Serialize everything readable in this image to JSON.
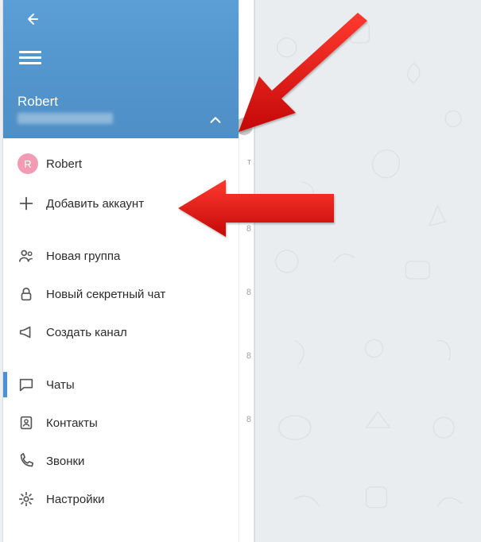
{
  "header": {
    "user_name": "Robert",
    "avatar_initial": "R"
  },
  "accounts": {
    "current_label": "Robert",
    "add_label": "Добавить аккаунт"
  },
  "menu": {
    "new_group": "Новая группа",
    "secret_chat": "Новый секретный чат",
    "create_channel": "Создать канал",
    "chats": "Чаты",
    "contacts": "Контакты",
    "calls": "Звонки",
    "settings": "Настройки"
  },
  "peek": {
    "t1": "т",
    "t2": "8",
    "t3": "8",
    "t4": "8",
    "t5": "8"
  },
  "colors": {
    "accent": "#4a90d9",
    "arrow": "#e81a1a"
  }
}
